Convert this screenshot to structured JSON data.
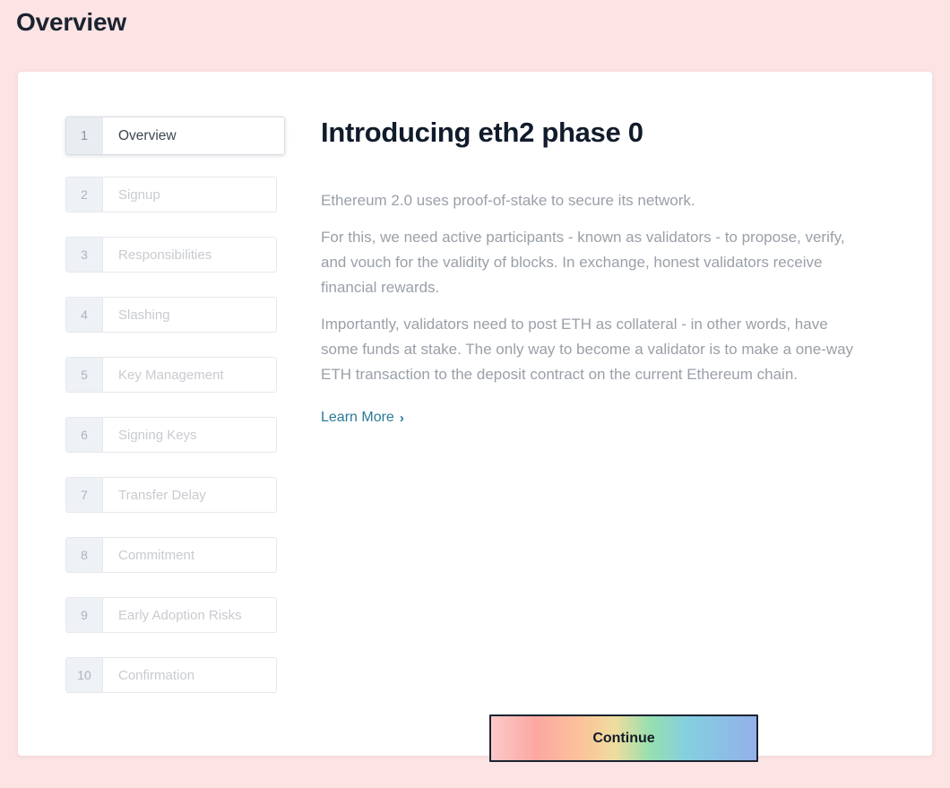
{
  "page": {
    "title": "Overview",
    "background_color": "#fce4e4",
    "card_color": "#ffffff"
  },
  "stepper": {
    "active_step": 1,
    "items": [
      {
        "number": "1",
        "label": "Overview"
      },
      {
        "number": "2",
        "label": "Signup"
      },
      {
        "number": "3",
        "label": "Responsibilities"
      },
      {
        "number": "4",
        "label": "Slashing"
      },
      {
        "number": "5",
        "label": "Key Management"
      },
      {
        "number": "6",
        "label": "Signing Keys"
      },
      {
        "number": "7",
        "label": "Transfer Delay"
      },
      {
        "number": "8",
        "label": "Commitment"
      },
      {
        "number": "9",
        "label": "Early Adoption Risks"
      },
      {
        "number": "10",
        "label": "Confirmation"
      }
    ]
  },
  "content": {
    "heading": "Introducing eth2 phase 0",
    "paragraphs": [
      "Ethereum 2.0 uses proof-of-stake to secure its network.",
      "For this, we need active participants - known as validators - to propose, verify, and vouch for the validity of blocks. In exchange, honest validators receive financial rewards.",
      "Importantly, validators need to post ETH as collateral - in other words, have some funds at stake. The only way to become a validator is to make a one-way ETH transaction to the deposit contract on the current Ethereum chain."
    ],
    "learn_more": {
      "label": "Learn More",
      "chevron": "›",
      "color": "#2b7a98"
    }
  },
  "footer": {
    "continue_label": "Continue"
  }
}
